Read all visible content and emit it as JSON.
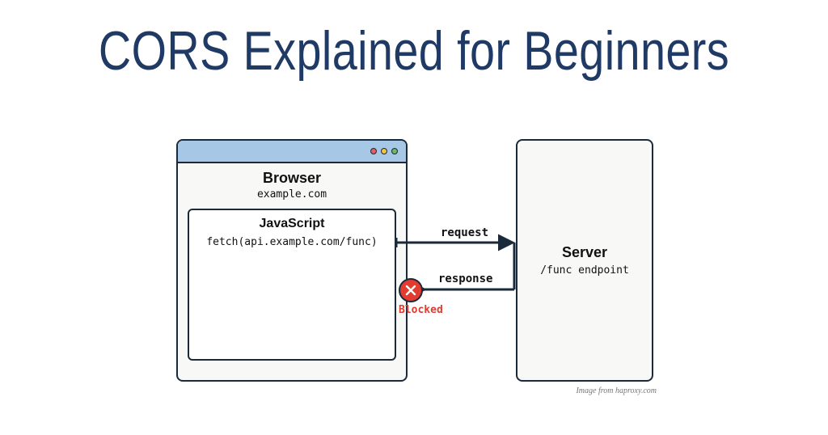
{
  "title": "CORS Explained for Beginners",
  "browser": {
    "label": "Browser",
    "domain": "example.com",
    "js": {
      "label": "JavaScript",
      "code": "fetch(api.example.com/func)"
    }
  },
  "server": {
    "label": "Server",
    "endpoint": "/func endpoint"
  },
  "arrows": {
    "request": "request",
    "response": "response"
  },
  "blocked": "Blocked",
  "credit": "Image from haproxy.com",
  "colors": {
    "title": "#203a66",
    "stroke": "#1b2a3a",
    "titlebar": "#a7c7e7",
    "blocked": "#e13c2f"
  }
}
